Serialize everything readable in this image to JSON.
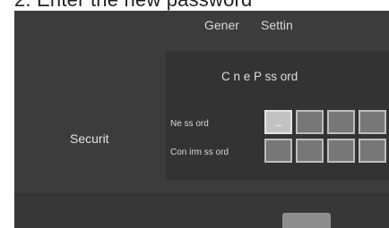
{
  "caption": "2. Enter the new password",
  "header": {
    "tabs": [
      {
        "label": "Gener"
      },
      {
        "label": "Settin"
      }
    ]
  },
  "sidebar": {
    "label": "Securit"
  },
  "dialog": {
    "title": "C  n e P ss  ord",
    "rows": [
      {
        "label": "Ne    ss  ord",
        "digits": [
          "_",
          "",
          "",
          ""
        ]
      },
      {
        "label": "Con irm    ss  ord",
        "digits": [
          "",
          "",
          "",
          ""
        ]
      }
    ]
  },
  "colors": {
    "device_bg": "#3c3c3c",
    "panel_bg": "#333333",
    "digit_bg": "#777777",
    "digit_active_bg": "#c2c2c2",
    "footer_button": "#8e8e8e"
  }
}
